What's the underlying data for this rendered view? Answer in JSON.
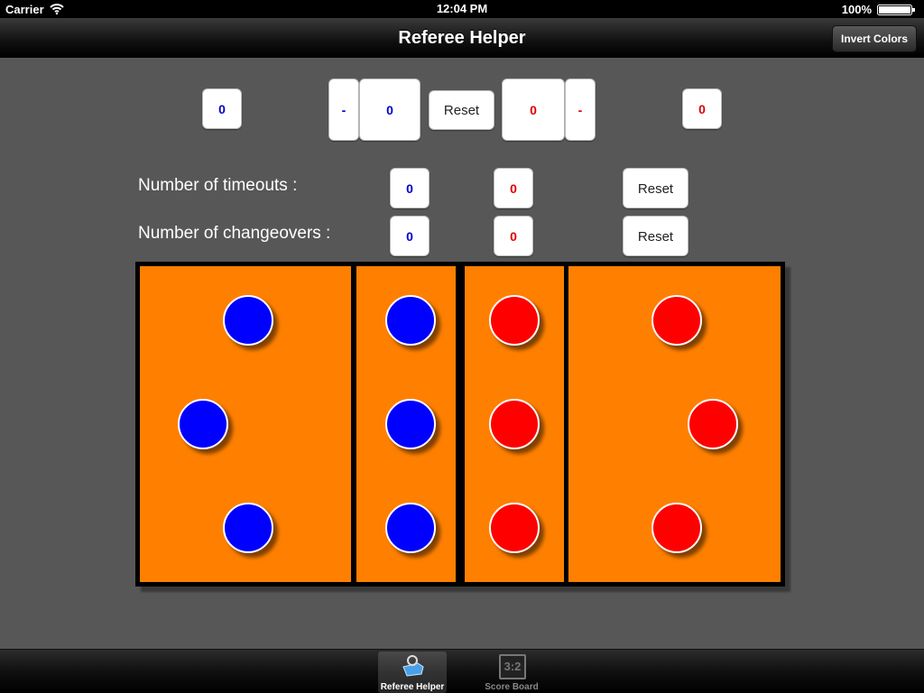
{
  "status_bar": {
    "carrier": "Carrier",
    "time": "12:04 PM",
    "battery": "100%"
  },
  "nav": {
    "title": "Referee Helper",
    "invert_label": "Invert Colors"
  },
  "score": {
    "blue_sets": "0",
    "blue_minus": "-",
    "blue_score": "0",
    "reset_label": "Reset",
    "red_score": "0",
    "red_minus": "-",
    "red_sets": "0"
  },
  "timeouts": {
    "label": "Number of timeouts :",
    "blue": "0",
    "red": "0",
    "reset_label": "Reset"
  },
  "changeovers": {
    "label": "Number of changeovers :",
    "blue": "0",
    "red": "0",
    "reset_label": "Reset"
  },
  "colors": {
    "blue_team": "#0000ff",
    "red_team": "#ff0000",
    "court": "#ff8000"
  },
  "tabs": [
    {
      "label": "Referee Helper",
      "icon": "whistle-icon",
      "active": true
    },
    {
      "label": "Score Board",
      "icon": "scoreboard-icon",
      "icon_text": "3:2",
      "active": false
    }
  ]
}
